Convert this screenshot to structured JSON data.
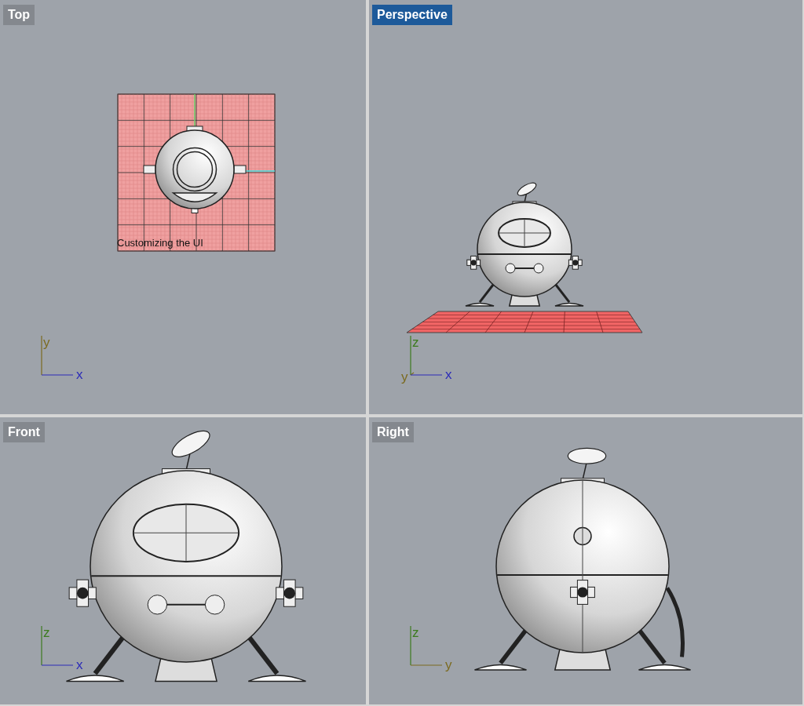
{
  "viewports": [
    {
      "title": "Top",
      "selected": false,
      "kind": "top",
      "plane_caption": "Customizing the UI",
      "axes": [
        {
          "label": "y",
          "kind": "vertical",
          "color": "#7b6a1e"
        },
        {
          "label": "x",
          "kind": "horizontal",
          "color": "#2c2cb8"
        }
      ]
    },
    {
      "title": "Perspective",
      "selected": true,
      "kind": "perspective",
      "axes": [
        {
          "label": "z",
          "kind": "vertical",
          "color": "#3c7a1e"
        },
        {
          "label": "y",
          "kind": "depth",
          "color": "#7b6a1e"
        },
        {
          "label": "x",
          "kind": "horizontal",
          "color": "#2c2cb8"
        }
      ]
    },
    {
      "title": "Front",
      "selected": false,
      "kind": "front",
      "axes": [
        {
          "label": "z",
          "kind": "vertical",
          "color": "#3c7a1e"
        },
        {
          "label": "x",
          "kind": "horizontal",
          "color": "#2c2cb8"
        }
      ]
    },
    {
      "title": "Right",
      "selected": false,
      "kind": "right",
      "axes": [
        {
          "label": "z",
          "kind": "vertical",
          "color": "#3c7a1e"
        },
        {
          "label": "y",
          "kind": "horizontal",
          "color": "#7b6a1e"
        }
      ]
    }
  ]
}
